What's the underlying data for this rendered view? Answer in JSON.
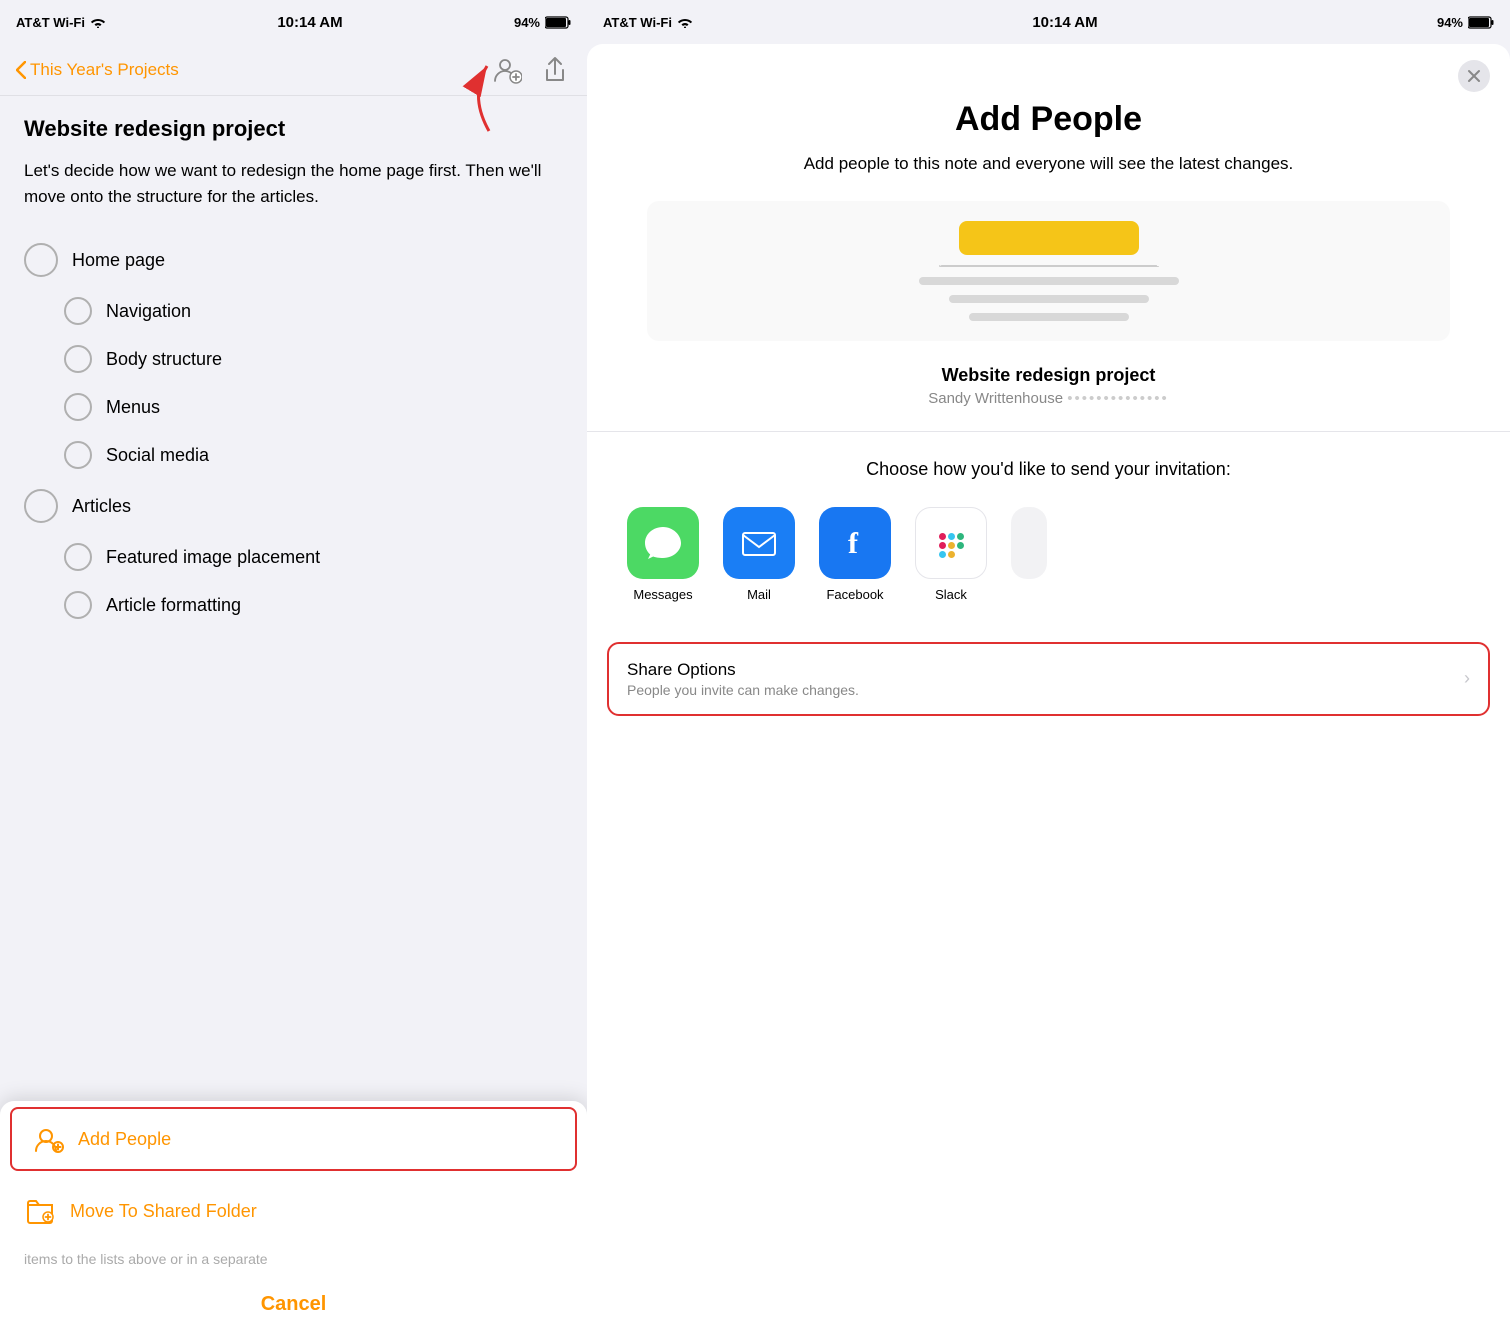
{
  "left": {
    "statusBar": {
      "carrier": "AT&T Wi-Fi",
      "time": "10:14 AM",
      "battery": "94%"
    },
    "navBack": "This Year's Projects",
    "noteTitle": "Website redesign project",
    "noteBody": "Let's decide how we want to redesign the home page first. Then we'll move onto the structure for the articles.",
    "checklist": [
      {
        "id": "home-page",
        "label": "Home page",
        "level": "parent"
      },
      {
        "id": "navigation",
        "label": "Navigation",
        "level": "child"
      },
      {
        "id": "body-structure",
        "label": "Body structure",
        "level": "child"
      },
      {
        "id": "menus",
        "label": "Menus",
        "level": "child"
      },
      {
        "id": "social-media",
        "label": "Social media",
        "level": "child"
      },
      {
        "id": "articles",
        "label": "Articles",
        "level": "parent"
      },
      {
        "id": "featured-image",
        "label": "Featured image placement",
        "level": "child"
      },
      {
        "id": "article-formatting",
        "label": "Article formatting",
        "level": "child"
      }
    ],
    "actionSheet": {
      "addPeopleLabel": "Add People",
      "moveToFolderLabel": "Move To Shared Folder",
      "fadedText": "items to the lists above or in a separate",
      "cancelLabel": "Cancel"
    }
  },
  "right": {
    "statusBar": {
      "carrier": "AT&T Wi-Fi",
      "time": "10:14 AM",
      "battery": "94%"
    },
    "sheetTitle": "Add People",
    "sheetSubtitle": "Add people to this note and everyone will see the latest changes.",
    "noteInfoTitle": "Website redesign project",
    "noteInfoOwner": "Sandy Writtenhouse",
    "inviteLabel": "Choose how you'd like to send your invitation:",
    "apps": [
      {
        "id": "messages",
        "label": "Messages"
      },
      {
        "id": "mail",
        "label": "Mail"
      },
      {
        "id": "facebook",
        "label": "Facebook"
      },
      {
        "id": "slack",
        "label": "Slack"
      }
    ],
    "shareOptions": {
      "title": "Share Options",
      "subtitle": "People you invite can make changes."
    }
  }
}
